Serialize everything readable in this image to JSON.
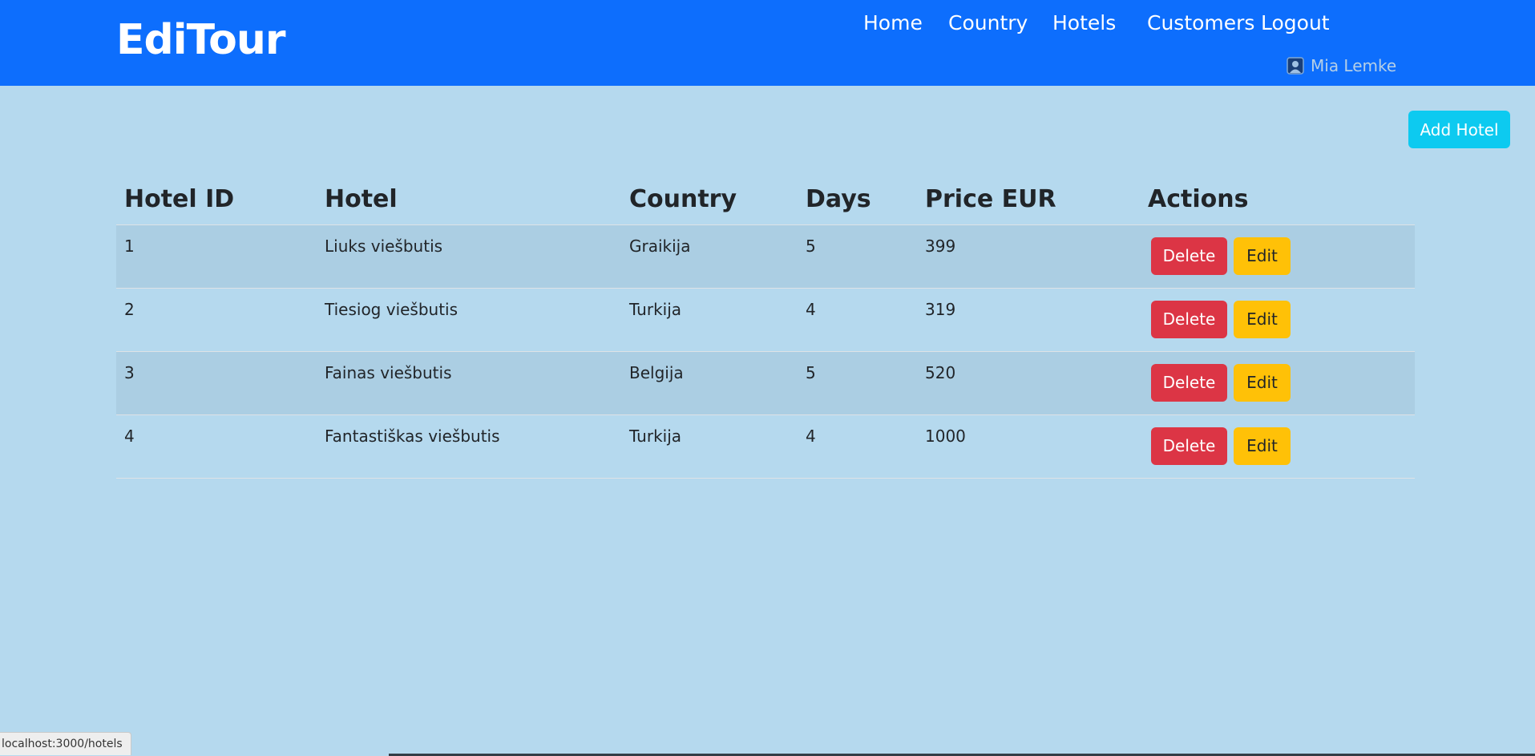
{
  "header": {
    "brand": "EdiTour",
    "nav": [
      "Home",
      "Country",
      "Hotels",
      "Customers",
      "Logout"
    ],
    "user_name": "Mia Lemke"
  },
  "toolbar": {
    "add_label": "Add Hotel"
  },
  "table": {
    "columns": [
      "Hotel ID",
      "Hotel",
      "Country",
      "Days",
      "Price EUR",
      "Actions"
    ],
    "rows": [
      {
        "id": "1",
        "hotel": "Liuks viešbutis",
        "country": "Graikija",
        "days": "5",
        "price": "399"
      },
      {
        "id": "2",
        "hotel": "Tiesiog viešbutis",
        "country": "Turkija",
        "days": "4",
        "price": "319"
      },
      {
        "id": "3",
        "hotel": "Fainas viešbutis",
        "country": "Belgija",
        "days": "5",
        "price": "520"
      },
      {
        "id": "4",
        "hotel": "Fantastiškas viešbutis",
        "country": "Turkija",
        "days": "4",
        "price": "1000"
      }
    ],
    "delete_label": "Delete",
    "edit_label": "Edit"
  },
  "status_bar": {
    "url": "localhost:3000/hotels"
  },
  "colors": {
    "navbar": "#0d6efd",
    "page_bg": "#b5d9ee",
    "add_button": "#0dcaf0",
    "delete_button": "#dc3545",
    "edit_button": "#ffc107"
  }
}
